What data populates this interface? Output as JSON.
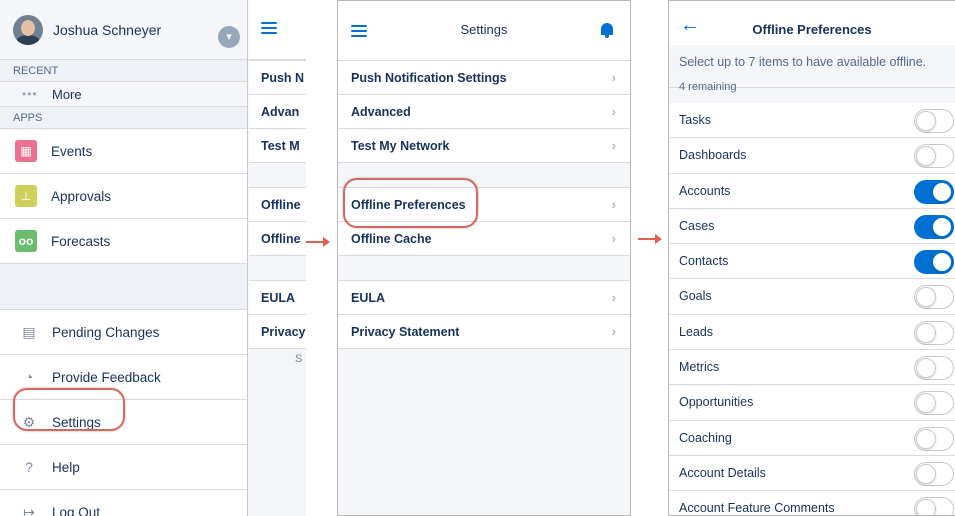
{
  "menu": {
    "user_name": "Joshua Schneyer",
    "recent_label": "RECENT",
    "more_label": "More",
    "apps_label": "APPS",
    "apps": [
      {
        "label": "Events",
        "icon": "calendar-icon",
        "color": "#eb7092"
      },
      {
        "label": "Approvals",
        "icon": "approval-icon",
        "color": "#cfd05c"
      },
      {
        "label": "Forecasts",
        "icon": "binoculars-icon",
        "color": "#6bbd6e"
      }
    ],
    "utilities": [
      {
        "label": "Pending Changes",
        "icon": "pending-changes-icon"
      },
      {
        "label": "Provide Feedback",
        "icon": "feedback-icon"
      },
      {
        "label": "Settings",
        "icon": "gear-icon"
      },
      {
        "label": "Help",
        "icon": "help-icon"
      },
      {
        "label": "Log Out",
        "icon": "logout-icon"
      }
    ]
  },
  "behind_rows": [
    "Push N",
    "Advan",
    "Test M",
    "Offline",
    "Offline",
    "EULA",
    "Privacy"
  ],
  "behind_footer": "S",
  "settings": {
    "title": "Settings",
    "groups": [
      [
        "Push Notification Settings",
        "Advanced",
        "Test My Network"
      ],
      [
        "Offline Preferences",
        "Offline Cache"
      ],
      [
        "EULA",
        "Privacy Statement"
      ]
    ]
  },
  "offline": {
    "title": "Offline Preferences",
    "instruction": "Select up to 7 items to have available offline.",
    "remaining": "4 remaining",
    "items": [
      {
        "label": "Tasks",
        "on": false
      },
      {
        "label": "Dashboards",
        "on": false
      },
      {
        "label": "Accounts",
        "on": true
      },
      {
        "label": "Cases",
        "on": true
      },
      {
        "label": "Contacts",
        "on": true
      },
      {
        "label": "Goals",
        "on": false
      },
      {
        "label": "Leads",
        "on": false
      },
      {
        "label": "Metrics",
        "on": false
      },
      {
        "label": "Opportunities",
        "on": false
      },
      {
        "label": "Coaching",
        "on": false
      },
      {
        "label": "Account Details",
        "on": false
      },
      {
        "label": "Account Feature Comments",
        "on": false
      }
    ]
  },
  "colors": {
    "accent": "#0070d2",
    "highlight": "#d8685e",
    "arrow": "#e0604f"
  }
}
